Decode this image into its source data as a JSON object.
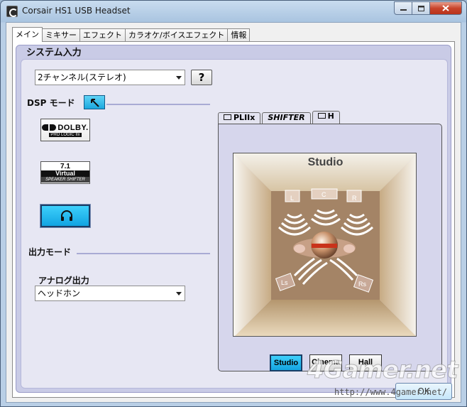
{
  "window": {
    "title": "Corsair HS1 USB Headset"
  },
  "tabs": [
    "メイン",
    "ミキサー",
    "エフェクト",
    "カラオケ/ボイスエフェクト",
    "情報"
  ],
  "system_input": {
    "label": "システム入力",
    "value": "2チャンネル(ステレオ)",
    "help": "?"
  },
  "dsp_mode": {
    "label": "DSP モード",
    "dolby": {
      "word": "DOLBY.",
      "sub": "PRO LOGIC IIx"
    },
    "virtual": {
      "num": "7.1",
      "word": "Virtual",
      "sub": "SPEAKER SHIFTER"
    }
  },
  "output_mode": {
    "label": "出力モード"
  },
  "analog_output": {
    "label": "アナログ出力",
    "value": "ヘッドホン"
  },
  "right_tabs": [
    "PLIIx",
    "SHIFTER",
    "H"
  ],
  "stage": {
    "title": "Studio",
    "speakers": {
      "l": "L",
      "c": "C",
      "r": "R",
      "ls": "Ls",
      "rs": "Rs"
    }
  },
  "env_buttons": [
    "Studio",
    "Cinema",
    "Hall"
  ],
  "watermark": {
    "logo": "4Gamer.net",
    "url": "http://www.4gamer.net/"
  },
  "ok_button": "OK",
  "colors": {
    "accent": "#1ba8de",
    "panel": "#c9cbe6",
    "stage_inner": "#a48466"
  }
}
